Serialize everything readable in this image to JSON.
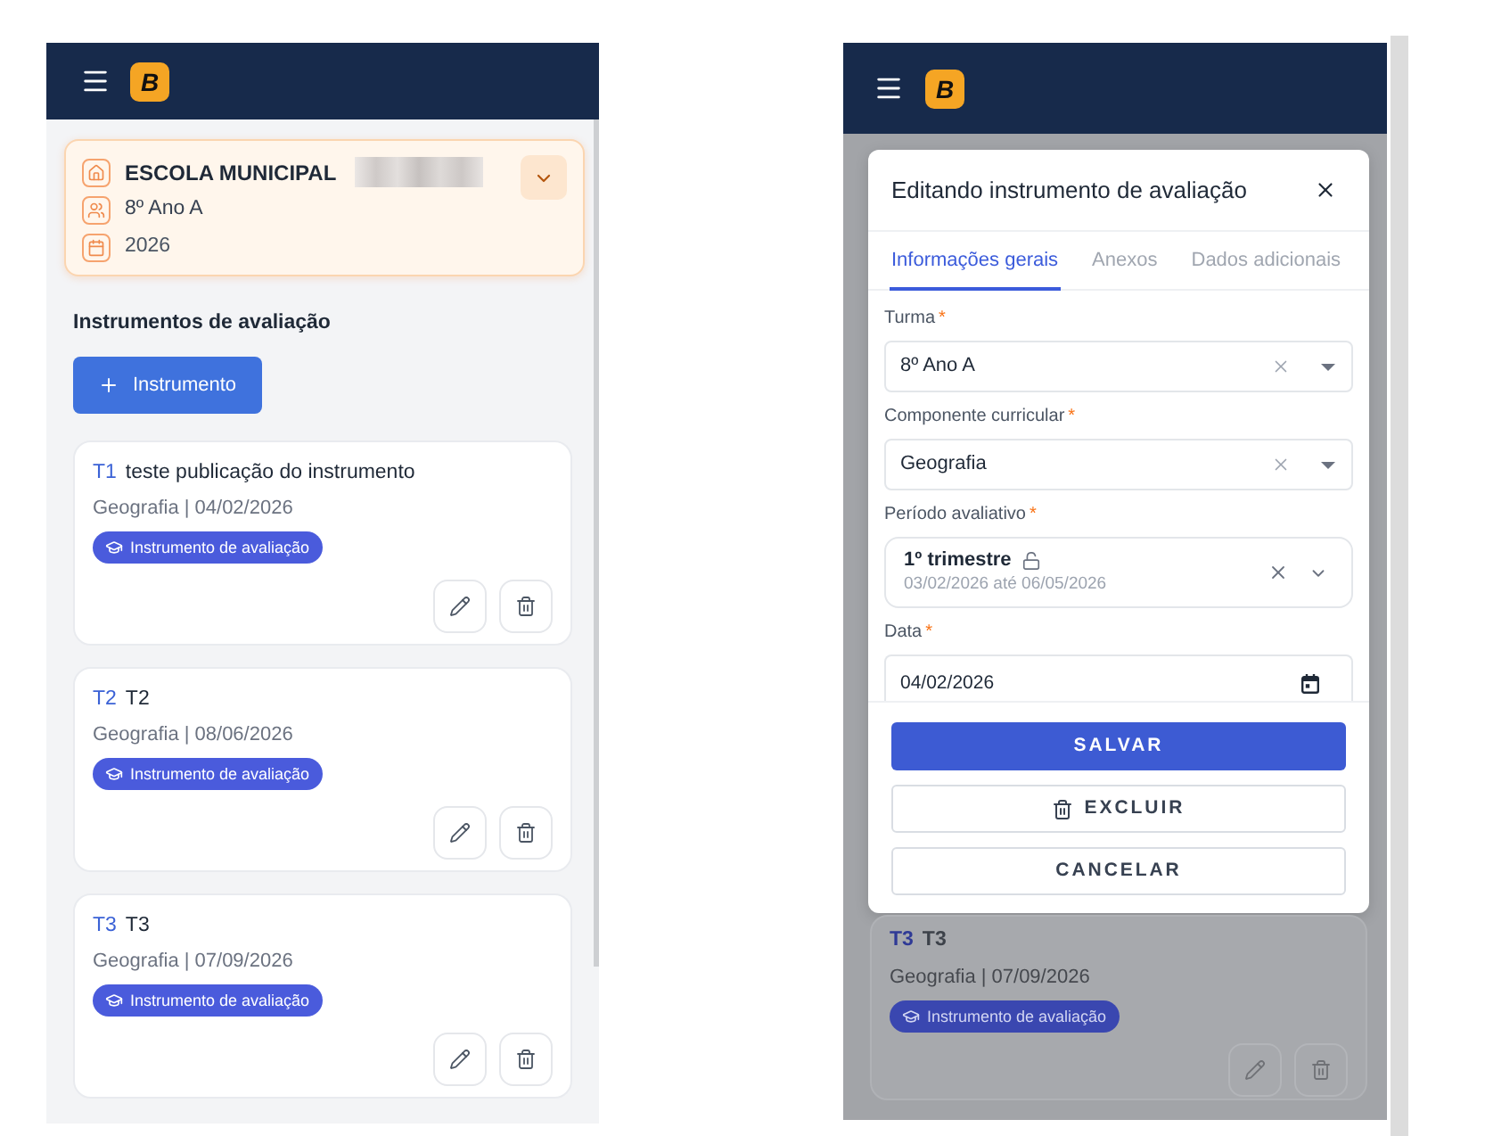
{
  "left_screen": {
    "header": {
      "logo": "B"
    },
    "school_card": {
      "rows": [
        {
          "kind": "school",
          "text": "ESCOLA MUNICIPAL",
          "redacted": true
        },
        {
          "kind": "class",
          "text": "8º Ano A",
          "redacted": false
        },
        {
          "kind": "year",
          "text": "2026",
          "redacted": false
        }
      ]
    },
    "section_title": "Instrumentos de avaliação",
    "add_button": {
      "label": "Instrumento"
    },
    "instruments": [
      {
        "code": "T1",
        "title": "teste publicação do instrumento",
        "subtitle": "Geografia | 04/02/2026",
        "badge": "Instrumento de avaliação"
      },
      {
        "code": "T2",
        "title": "T2",
        "subtitle": "Geografia | 08/06/2026",
        "badge": "Instrumento de avaliação"
      },
      {
        "code": "T3",
        "title": "T3",
        "subtitle": "Geografia | 07/09/2026",
        "badge": "Instrumento de avaliação"
      }
    ]
  },
  "right_screen": {
    "header": {
      "logo": "B"
    },
    "modal": {
      "title": "Editando instrumento de avaliação",
      "tabs": [
        {
          "label": "Informações gerais",
          "selected": true
        },
        {
          "label": "Anexos",
          "selected": false
        },
        {
          "label": "Dados adicionais",
          "selected": false
        }
      ],
      "fields": [
        {
          "kind": "select",
          "label": "Turma",
          "required_mark": "*",
          "value": "8º Ano A"
        },
        {
          "kind": "select",
          "label": "Componente curricular",
          "required_mark": "*",
          "value": "Geografia"
        },
        {
          "kind": "period",
          "label": "Período avaliativo",
          "required_mark": "*",
          "value": "1º trimestre",
          "detail": "03/02/2026 até 06/05/2026"
        },
        {
          "kind": "date",
          "label": "Data",
          "required_mark": "*",
          "value": "04/02/2026"
        }
      ],
      "buttons": [
        {
          "kind": "primary",
          "label": "SALVAR"
        },
        {
          "kind": "delete",
          "label": "EXCLUIR"
        },
        {
          "kind": "secondary",
          "label": "CANCELAR"
        }
      ]
    },
    "background_card": {
      "code": "T3",
      "title": "T3",
      "subtitle": "Geografia | 07/09/2026",
      "badge": "Instrumento de avaliação"
    }
  }
}
